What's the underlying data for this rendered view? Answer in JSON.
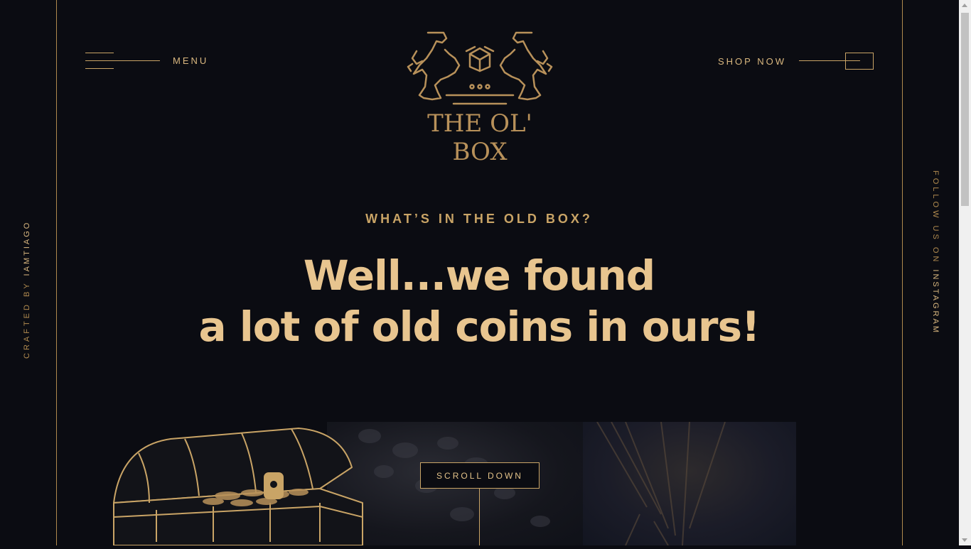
{
  "header": {
    "menu_label": "MENU",
    "shop_label": "SHOP NOW",
    "logo_text": "THE OL' BOX"
  },
  "sidebar_left": {
    "prefix": "CRAFTED BY",
    "name": "IAMTIAGO"
  },
  "sidebar_right": {
    "prefix": "FOLLOW US ON",
    "name": "INSTAGRAM"
  },
  "hero": {
    "eyebrow": "WHAT’S IN THE OLD BOX?",
    "headline_line1": "Well...we found",
    "headline_line2": "a lot of old coins in ours!",
    "scroll_label": "SCROLL DOWN"
  },
  "colors": {
    "background": "#0b0c12",
    "gold": "#c9a466",
    "gold_light": "#e8c58f"
  },
  "icons": [
    "hamburger-icon",
    "arrow-box-icon",
    "lion-crest-icon",
    "treasure-chest-illustration"
  ]
}
